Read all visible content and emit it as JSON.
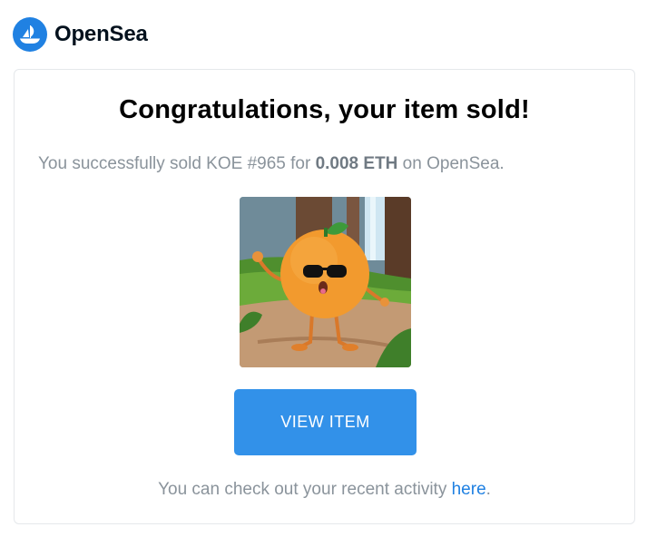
{
  "brand": {
    "name": "OpenSea",
    "logo_icon": "opensea-ship-icon",
    "color": "#2081e2"
  },
  "email": {
    "title": "Congratulations, your item sold!",
    "sold_prefix": "You successfully sold KOE #965 for ",
    "price": "0.008 ETH",
    "sold_suffix": " on OpenSea.",
    "button_label": "VIEW ITEM",
    "activity_prefix": "You can check out your recent activity ",
    "activity_link": "here",
    "activity_suffix": "."
  },
  "colors": {
    "button": "#3291e9",
    "link": "#2081e2",
    "muted_text": "#8a939b"
  }
}
